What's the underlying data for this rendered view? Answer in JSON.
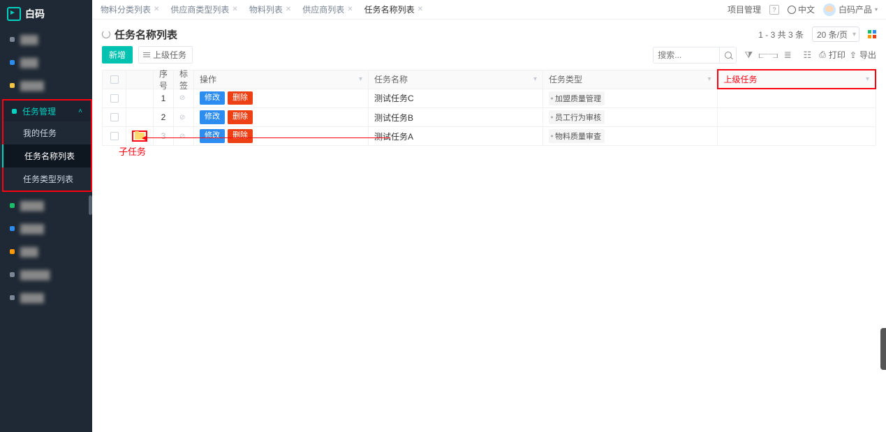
{
  "logo": "白码",
  "sidebar": {
    "blur_items_top": [
      {
        "dot": "dot-gray"
      },
      {
        "dot": "dot-blue"
      },
      {
        "dot": "dot-yellow"
      }
    ],
    "section_head": "任务管理",
    "sub_items": [
      "我的任务",
      "任务名称列表",
      "任务类型列表"
    ],
    "active_sub": 1,
    "blur_items_bottom": [
      {
        "dot": "dot-green"
      },
      {
        "dot": "dot-blue"
      },
      {
        "dot": "dot-orange"
      },
      {
        "dot": "dot-gray"
      },
      {
        "dot": "dot-gray"
      }
    ]
  },
  "tabs": [
    "物料分类列表",
    "供应商类型列表",
    "物料列表",
    "供应商列表",
    "任务名称列表"
  ],
  "active_tab": 4,
  "header_right": {
    "project": "项目管理",
    "lang": "中文",
    "user": "白码产品"
  },
  "page": {
    "title": "任务名称列表",
    "pager": "1 - 3  共  3  条",
    "page_size": "20 条/页"
  },
  "toolbar": {
    "add": "新增",
    "parent_task": "上级任务",
    "search_ph": "搜索...",
    "print": "打印",
    "export": "导出"
  },
  "columns": {
    "seq": "序号",
    "tag": "标签",
    "op": "操作",
    "name": "任务名称",
    "type": "任务类型",
    "parent": "上级任务"
  },
  "ops": {
    "edit": "修改",
    "del": "删除"
  },
  "rows": [
    {
      "seq": "1",
      "name": "测试任务C",
      "type": "加盟质量管理",
      "fold": false
    },
    {
      "seq": "2",
      "name": "测试任务B",
      "type": "员工行为审核",
      "fold": false
    },
    {
      "seq": "3",
      "name": "测试任务A",
      "type": "物料质量审查",
      "fold": true
    }
  ],
  "annotation": "子任务"
}
